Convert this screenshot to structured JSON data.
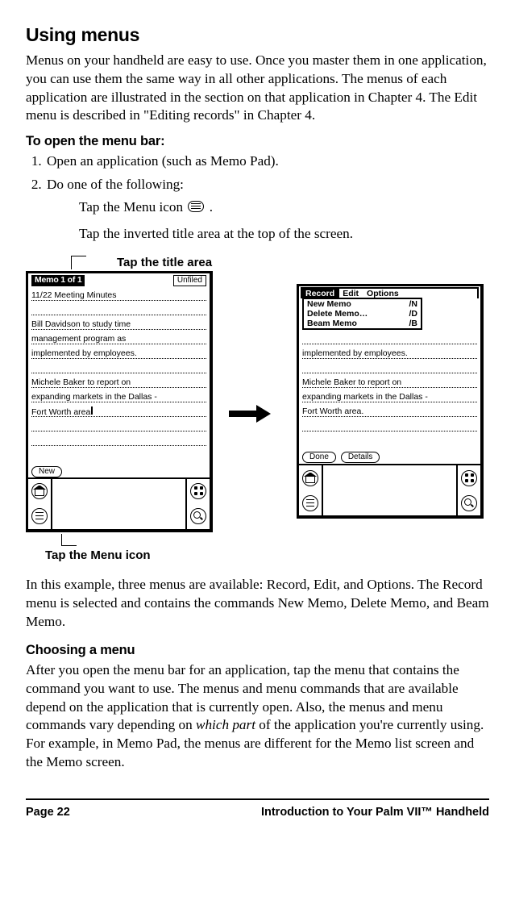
{
  "title": "Using menus",
  "para_intro": "Menus on your handheld are easy to use. Once you master them in one application, you can use them the same way in all other applications. The menus of each application are illustrated in the section on that application in Chapter 4. The Edit menu is described in \"Editing records\" in Chapter 4.",
  "subhead_open": "To open the menu bar:",
  "steps": {
    "s1": "Open an application (such as Memo Pad).",
    "s2": "Do one of the following:",
    "sub_a_pre": "Tap the Menu icon ",
    "sub_a_post": " .",
    "sub_b": "Tap the inverted title area at the top of the screen."
  },
  "callouts": {
    "title_area": "Tap the title area",
    "menu_icon": "Tap the Menu icon"
  },
  "screen_left": {
    "titlebar": "Memo 1 of 1",
    "category": "Unfiled",
    "line1": "11/22 Meeting Minutes",
    "line2": "Bill Davidson to study time",
    "line3": "management program as",
    "line4": "implemented by employees.",
    "line5": "Michele Baker to report on",
    "line6": "expanding markets in the Dallas -",
    "line7": "Fort Worth area",
    "btn_new": "New"
  },
  "screen_right": {
    "menus": {
      "record": "Record",
      "edit": "Edit",
      "options": "Options"
    },
    "items": {
      "new": {
        "label": "New Memo",
        "shortcut": "/N"
      },
      "delete": {
        "label": "Delete Memo…",
        "shortcut": "/D"
      },
      "beam": {
        "label": "Beam Memo",
        "shortcut": "/B"
      }
    },
    "line4": "implemented by employees.",
    "line5": "Michele Baker to report on",
    "line6": "expanding markets in the Dallas -",
    "line7": "Fort Worth area.",
    "btn_done": "Done",
    "btn_details": "Details"
  },
  "para_example": "In this example, three menus are available: Record, Edit, and Options. The Record menu is selected and contains the commands New Memo, Delete Memo, and Beam Memo.",
  "subhead_choosing": "Choosing a menu",
  "para_choosing_a": "After you open the menu bar for an application, tap the menu that contains the command you want to use. The menus and menu commands that are available depend on the application that is currently open. Also, the menus and menu commands vary depending on ",
  "para_choosing_italic": "which part",
  "para_choosing_b": " of the application you're currently using. For example, in Memo Pad, the menus are different for the Memo list screen and the Memo screen.",
  "footer": {
    "left": "Page 22",
    "right": "Introduction to Your Palm VII™ Handheld"
  }
}
